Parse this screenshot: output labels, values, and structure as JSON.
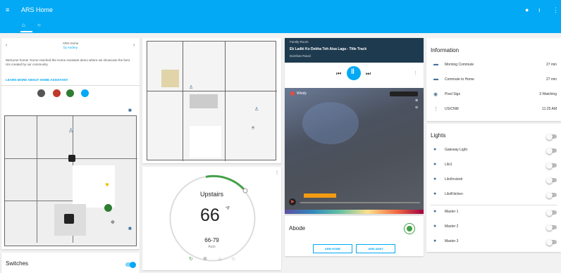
{
  "app": {
    "title": "ARS Home",
    "accent": "#03a9f4"
  },
  "icons": {
    "menu": "menu-icon",
    "bell": "bell-icon",
    "mic": "microphone-icon",
    "more": "more-vert-icon",
    "home": "home-icon",
    "tab2": "circle-tab-icon"
  },
  "welcome": {
    "title": "ARS Home",
    "subtitle": "by Andrey",
    "text": "Welcome home! You've reached the Home Assistant demo where we showcase the best UIs created by our community.",
    "link": "LEARN MORE ABOUT HOME ASSISTANT"
  },
  "switches": {
    "title": "Switches"
  },
  "thermostat": {
    "name": "Upstairs",
    "temp": "66",
    "unit": "°F",
    "range": "66-79",
    "mode": "Auto"
  },
  "media": {
    "source": "Family Room",
    "track": "Ek Ladki Ko Dekha Toh Aisa Laga - Title Track",
    "artist": "Darshan Raval"
  },
  "map": {
    "label": "Windy"
  },
  "alarm": {
    "name": "Abode",
    "arm_home": "ARM HOME",
    "arm_away": "ARM AWAY"
  },
  "information": {
    "title": "Information",
    "rows": [
      {
        "label": "Morning Commute",
        "value": "27 min"
      },
      {
        "label": "Commute to Home",
        "value": "27 min"
      },
      {
        "label": "Pixel Sigs",
        "value": "3 Watching"
      },
      {
        "label": "US/CNM",
        "value": "11:25 AM"
      }
    ]
  },
  "lights": {
    "title": "Lights",
    "groups": [
      [
        "Gateway Light",
        "Lilo1",
        "Lilo/Invisiclr",
        "Lilo/Kitchen"
      ],
      [
        "Master 1",
        "Master 2",
        "Master 3"
      ]
    ]
  }
}
